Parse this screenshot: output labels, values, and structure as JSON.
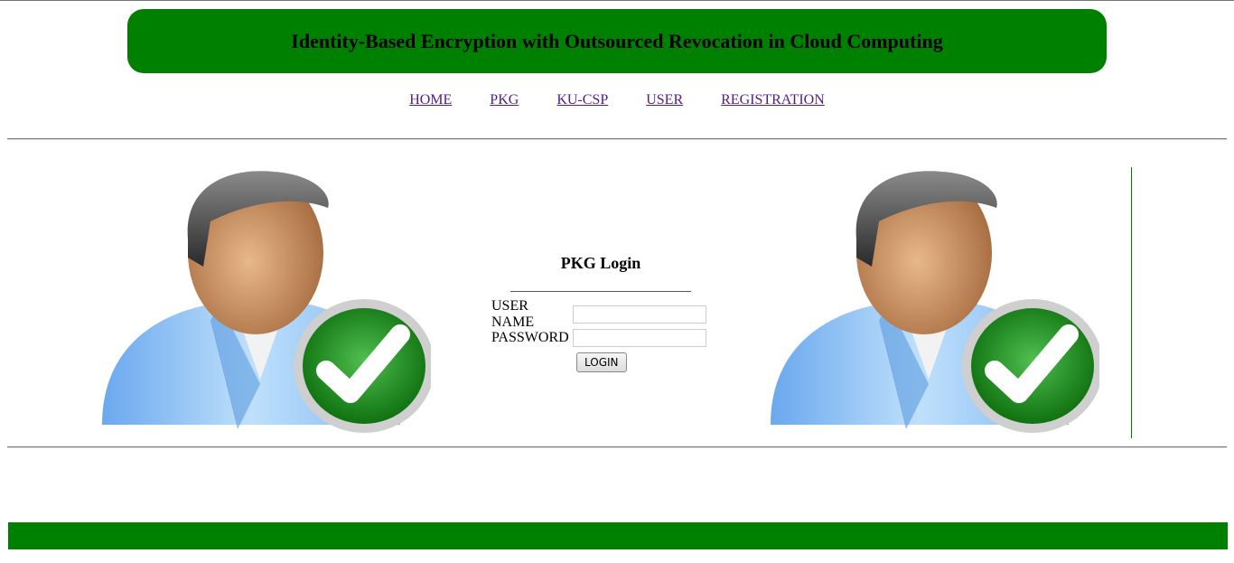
{
  "header": {
    "title": "Identity-Based Encryption with Outsourced Revocation in Cloud Computing"
  },
  "nav": {
    "items": [
      {
        "label": "HOME"
      },
      {
        "label": "PKG"
      },
      {
        "label": "KU-CSP"
      },
      {
        "label": "USER"
      },
      {
        "label": "REGISTRATION"
      }
    ]
  },
  "login": {
    "title": "PKG Login",
    "username_label": "USER NAME",
    "username_value": "",
    "password_label": "PASSWORD",
    "password_value": "",
    "button_label": "LOGIN"
  },
  "images": {
    "left": {
      "icon": "user-verified-icon"
    },
    "right": {
      "icon": "user-verified-icon"
    }
  },
  "colors": {
    "brand_green": "#008000",
    "link": "#551a8b",
    "shirt_blue": "#7fb6f2",
    "skin": "#d39a6a",
    "hair": "#4a4a4a"
  }
}
